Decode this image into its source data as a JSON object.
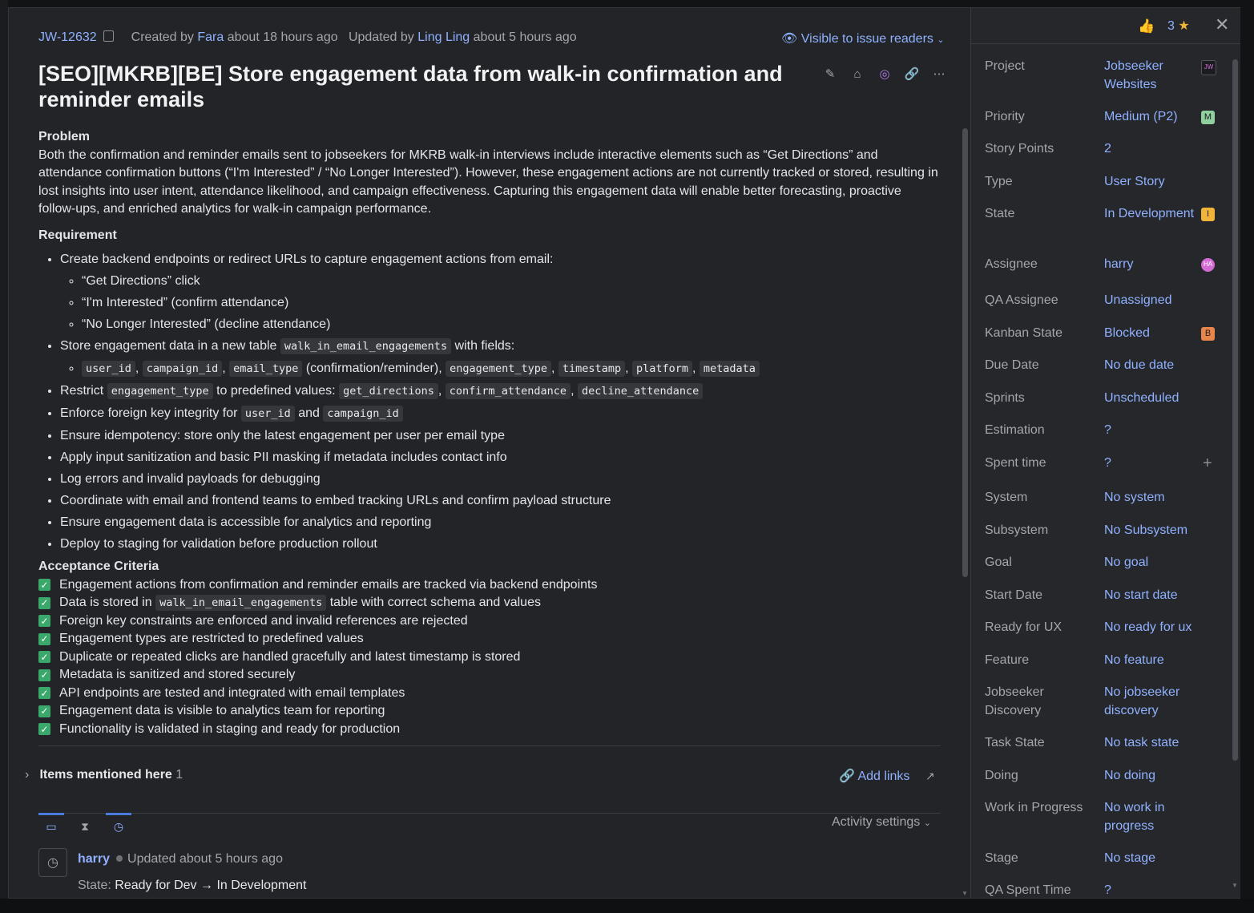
{
  "issue": {
    "id": "JW-12632",
    "created_prefix": "Created by",
    "created_by": "Fara",
    "created_ago": "about 18 hours ago",
    "updated_prefix": "Updated by",
    "updated_by": "Ling Ling",
    "updated_ago": "about 5 hours ago",
    "visibility": "Visible to issue readers",
    "title": "[SEO][MKRB][BE] Store engagement data from walk-in confirmation and reminder emails"
  },
  "description": {
    "problem_heading": "Problem",
    "problem_text": "Both the confirmation and reminder emails sent to jobseekers for MKRB walk-in interviews include interactive elements such as “Get Directions” and attendance confirmation buttons (“I'm Interested” / “No Longer Interested”). However, these engagement actions are not currently tracked or stored, resulting in lost insights into user intent, attendance likelihood, and campaign effectiveness. Capturing this engagement data will enable better forecasting, proactive follow-ups, and enriched analytics for walk-in campaign performance.",
    "requirement_heading": "Requirement",
    "req1": "Create backend endpoints or redirect URLs to capture engagement actions from email:",
    "req1_sub": [
      "“Get Directions” click",
      "“I'm Interested” (confirm attendance)",
      "“No Longer Interested” (decline attendance)"
    ],
    "req2_a": "Store engagement data in a new table",
    "req2_code": "walk_in_email_engagements",
    "req2_b": "with fields:",
    "fields_codes": [
      "user_id",
      "campaign_id",
      "email_type",
      "engagement_type",
      "timestamp",
      "platform",
      "metadata"
    ],
    "fields_note": "(confirmation/reminder),",
    "req3_a": "Restrict",
    "req3_code": "engagement_type",
    "req3_b": "to predefined values:",
    "req3_values": [
      "get_directions",
      "confirm_attendance",
      "decline_attendance"
    ],
    "req4_a": "Enforce foreign key integrity for",
    "req4_code1": "user_id",
    "req4_and": "and",
    "req4_code2": "campaign_id",
    "req_rest": [
      "Ensure idempotency: store only the latest engagement per user per email type",
      "Apply input sanitization and basic PII masking if metadata includes contact info",
      "Log errors and invalid payloads for debugging",
      "Coordinate with email and frontend teams to embed tracking URLs and confirm payload structure",
      "Ensure engagement data is accessible for analytics and reporting",
      "Deploy to staging for validation before production rollout"
    ],
    "acceptance_heading": "Acceptance Criteria",
    "ac1": "Engagement actions from confirmation and reminder emails are tracked via backend endpoints",
    "ac2_a": "Data is stored in",
    "ac2_code": "walk_in_email_engagements",
    "ac2_b": "table with correct schema and values",
    "ac_rest": [
      "Foreign key constraints are enforced and invalid references are rejected",
      "Engagement types are restricted to predefined values",
      "Duplicate or repeated clicks are handled gracefully and latest timestamp is stored",
      "Metadata is sanitized and stored securely",
      "API endpoints are tested and integrated with email templates",
      "Engagement data is visible to analytics team for reporting",
      "Functionality is validated in staging and ready for production"
    ]
  },
  "links": {
    "mentioned_label": "Items mentioned here",
    "mentioned_count": "1",
    "add_links": "Add links"
  },
  "activity": {
    "settings_label": "Activity settings",
    "author": "harry",
    "when": "Updated about 5 hours ago",
    "change_label": "State:",
    "change_from": "Ready for Dev",
    "change_arrow": "→",
    "change_to": "In Development"
  },
  "sidebar": {
    "votes": "3",
    "fields": [
      {
        "label": "Project",
        "value": "Jobseeker Websites",
        "badge": "JW",
        "badge_color": "#1b1c1f"
      },
      {
        "label": "Priority",
        "value": "Medium (P2)",
        "badge": "M",
        "badge_color": "#8fd19e"
      },
      {
        "label": "Story Points",
        "value": "2"
      },
      {
        "label": "Type",
        "value": "User Story"
      },
      {
        "label": "State",
        "value": "In Development",
        "badge": "I",
        "badge_color": "#f0b43a"
      },
      {
        "label": "Assignee",
        "value": "harry",
        "badge": "HA",
        "badge_color": "#d36bd6"
      },
      {
        "label": "QA Assignee",
        "value": "Unassigned"
      },
      {
        "label": "Kanban State",
        "value": "Blocked",
        "badge": "B",
        "badge_color": "#e8854a"
      },
      {
        "label": "Due Date",
        "value": "No due date"
      },
      {
        "label": "Sprints",
        "value": "Unscheduled"
      },
      {
        "label": "Estimation",
        "value": "?"
      },
      {
        "label": "Spent time",
        "value": "?"
      },
      {
        "label": "System",
        "value": "No system"
      },
      {
        "label": "Subsystem",
        "value": "No Subsystem"
      },
      {
        "label": "Goal",
        "value": "No goal"
      },
      {
        "label": "Start Date",
        "value": "No start date"
      },
      {
        "label": "Ready for UX",
        "value": "No ready for ux"
      },
      {
        "label": "Feature",
        "value": "No feature"
      },
      {
        "label": "Jobseeker Discovery",
        "value": "No jobseeker discovery"
      },
      {
        "label": "Task State",
        "value": "No task state"
      },
      {
        "label": "Doing",
        "value": "No doing"
      },
      {
        "label": "Work in Progress",
        "value": "No work in progress"
      },
      {
        "label": "Stage",
        "value": "No stage"
      },
      {
        "label": "QA Spent Time",
        "value": "?"
      }
    ]
  }
}
